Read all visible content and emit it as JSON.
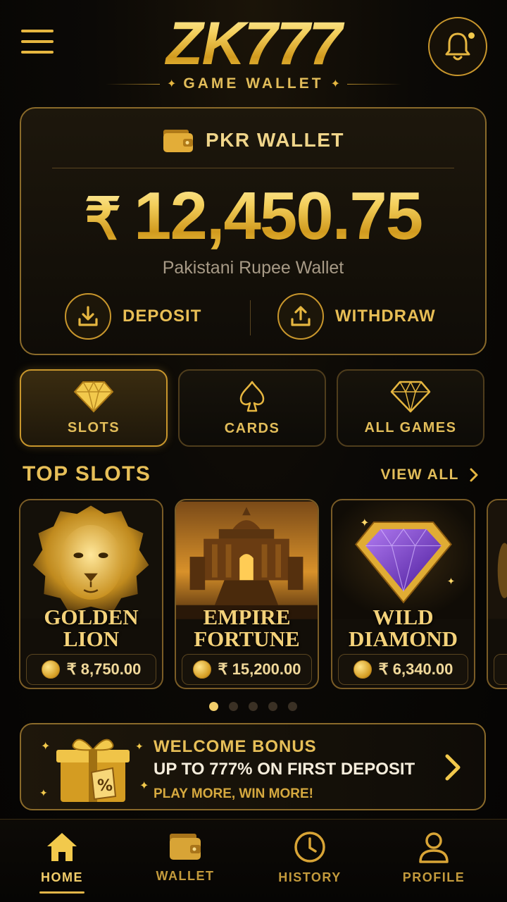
{
  "header": {
    "logo": "ZK777",
    "subtitle": "GAME WALLET",
    "menu_icon": "hamburger-menu-icon",
    "notification_icon": "bell-icon"
  },
  "wallet": {
    "title": "PKR WALLET",
    "currency_symbol": "₹",
    "balance": "12,450.75",
    "description": "Pakistani Rupee Wallet",
    "actions": [
      {
        "label": "DEPOSIT",
        "icon": "download-icon"
      },
      {
        "label": "WITHDRAW",
        "icon": "upload-icon"
      }
    ]
  },
  "categories": [
    {
      "label": "SLOTS",
      "icon": "diamond-icon",
      "active": true
    },
    {
      "label": "CARDS",
      "icon": "spade-icon",
      "active": false
    },
    {
      "label": "ALL GAMES",
      "icon": "diamond-outline-icon",
      "active": false
    }
  ],
  "top_slots": {
    "title": "TOP SLOTS",
    "view_all": "VIEW ALL",
    "items": [
      {
        "name_line1": "GOLDEN",
        "name_line2": "LION",
        "amount": "₹ 8,750.00"
      },
      {
        "name_line1": "EMPIRE",
        "name_line2": "FORTUNE",
        "amount": "₹ 15,200.00"
      },
      {
        "name_line1": "WILD",
        "name_line2": "DIAMOND",
        "amount": "₹ 6,340.00"
      }
    ],
    "pagination": {
      "pages": 5,
      "active": 1
    }
  },
  "bonus": {
    "title": "WELCOME BONUS",
    "offer": "UP TO 777% ON FIRST DEPOSIT",
    "tagline": "PLAY MORE, WIN MORE!",
    "icon": "gift-icon"
  },
  "bottom_nav": [
    {
      "label": "HOME",
      "icon": "home-icon",
      "active": true
    },
    {
      "label": "WALLET",
      "icon": "wallet-icon",
      "active": false
    },
    {
      "label": "HISTORY",
      "icon": "clock-icon",
      "active": false
    },
    {
      "label": "PROFILE",
      "icon": "user-icon",
      "active": false
    }
  ],
  "colors": {
    "accent_gold": "#e7bf58",
    "background": "#0b0906",
    "border_gold": "#8a6a2a"
  }
}
